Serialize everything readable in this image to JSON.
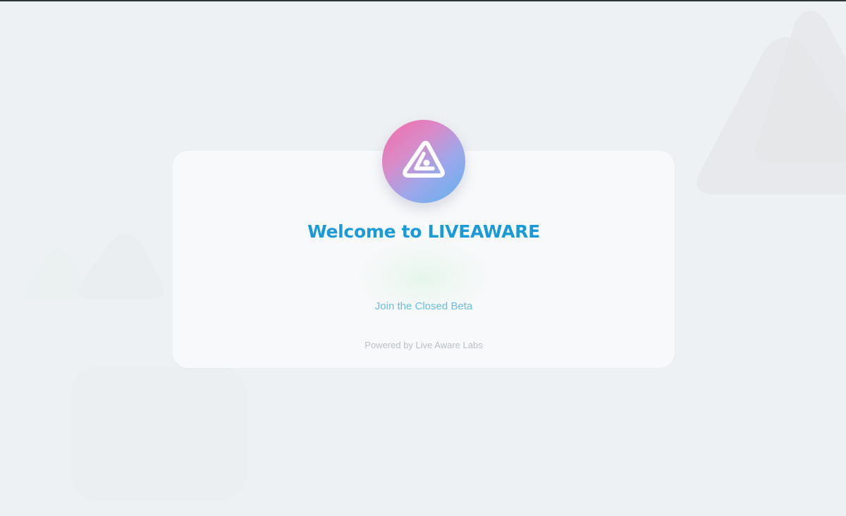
{
  "welcome": {
    "title": "Welcome to LIVEAWARE",
    "cta_label": "Join the Closed Beta",
    "powered_by": "Powered by Live Aware Labs"
  },
  "logo": {
    "icon": "liveaware-logo-icon",
    "gradient": [
      "#f56aa8",
      "#5fb2ee"
    ]
  },
  "colors": {
    "background": "#eef1f3",
    "title": "#1a9ad6",
    "link": "#67bfe5",
    "muted": "#b9bfc3"
  }
}
